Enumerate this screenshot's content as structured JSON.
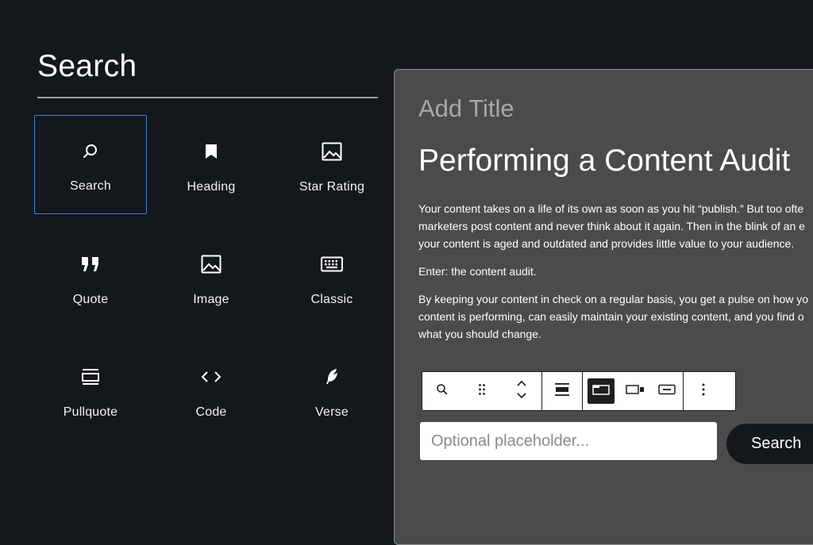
{
  "inserter": {
    "heading": "Search",
    "blocks": [
      {
        "label": "Search",
        "icon": "search-icon"
      },
      {
        "label": "Heading",
        "icon": "bookmark-icon"
      },
      {
        "label": "Star Rating",
        "icon": "image-icon"
      },
      {
        "label": "Quote",
        "icon": "quote-icon"
      },
      {
        "label": "Image",
        "icon": "image-icon"
      },
      {
        "label": "Classic",
        "icon": "keyboard-icon"
      },
      {
        "label": "Pullquote",
        "icon": "pullquote-icon"
      },
      {
        "label": "Code",
        "icon": "code-icon"
      },
      {
        "label": "Verse",
        "icon": "feather-icon"
      }
    ],
    "selected_block": "Search"
  },
  "editor": {
    "title_placeholder": "Add Title",
    "post_title": "Performing a Content Audit",
    "paragraph1": [
      "Your content takes on a life of its own as soon as you hit “publish.” But too ofte",
      "marketers post content and never think about it again. Then in the blink of an e",
      "your content is aged and outdated and provides little value to your audience."
    ],
    "paragraph2": "Enter: the content audit.",
    "paragraph3": [
      "By keeping your content in check on a regular basis, you get a pulse on how yo",
      "content is performing, can easily maintain your existing content, and you find o",
      "what you should change."
    ],
    "toolbar": {
      "buttons": [
        "search-icon",
        "drag-handle-icon",
        "move-up-down-icon",
        "align-icon",
        "button-inside-icon",
        "button-outside-icon",
        "no-button-icon",
        "more-options-icon"
      ],
      "active": "button-inside-icon"
    },
    "search_block": {
      "placeholder": "Optional placeholder...",
      "button_label": "Search"
    }
  },
  "colors": {
    "background": "#14171c",
    "editor_bg": "#4b4b4b",
    "selection_border": "#3f7fd6",
    "toolbar_bg": "#ffffff"
  }
}
